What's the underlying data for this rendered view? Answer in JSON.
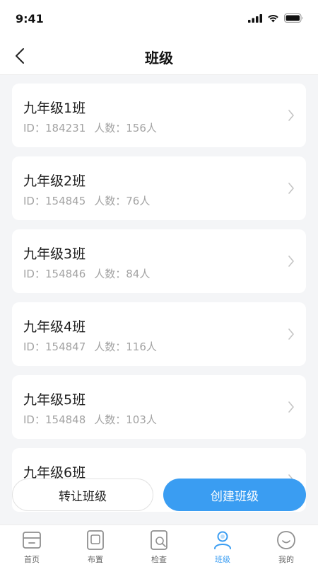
{
  "status": {
    "time": "9:41"
  },
  "header": {
    "title": "班级"
  },
  "meta_labels": {
    "id_prefix": "ID：",
    "count_prefix": "人数：",
    "count_suffix": "人"
  },
  "classes": [
    {
      "name": "九年级1班",
      "id": "184231",
      "count": "156"
    },
    {
      "name": "九年级2班",
      "id": "154845",
      "count": "76"
    },
    {
      "name": "九年级3班",
      "id": "154846",
      "count": "84"
    },
    {
      "name": "九年级4班",
      "id": "154847",
      "count": "116"
    },
    {
      "name": "九年级5班",
      "id": "154848",
      "count": "103"
    },
    {
      "name": "九年级6班"
    }
  ],
  "actions": {
    "transfer_label": "转让班级",
    "create_label": "创建班级"
  },
  "tabs": [
    {
      "label": "首页",
      "icon": "home-icon"
    },
    {
      "label": "布置",
      "icon": "assign-icon"
    },
    {
      "label": "检查",
      "icon": "check-icon"
    },
    {
      "label": "班级",
      "icon": "class-icon"
    },
    {
      "label": "我的",
      "icon": "profile-icon"
    }
  ],
  "colors": {
    "accent": "#3a9df2",
    "active_tab": "#3a9df2",
    "meta_text": "#a3a3a3"
  }
}
